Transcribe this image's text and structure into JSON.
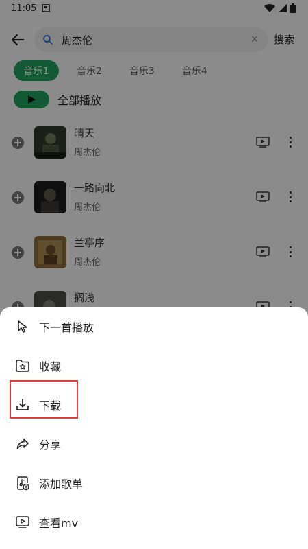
{
  "status_bar": {
    "time": "11:05"
  },
  "search": {
    "query": "周杰伦",
    "button_label": "搜索"
  },
  "tabs": [
    {
      "label": "音乐1",
      "active": true
    },
    {
      "label": "音乐2",
      "active": false
    },
    {
      "label": "音乐3",
      "active": false
    },
    {
      "label": "音乐4",
      "active": false
    }
  ],
  "play_all": {
    "label": "全部播放"
  },
  "songs": [
    {
      "title": "晴天",
      "artist": "周杰伦"
    },
    {
      "title": "一路向北",
      "artist": "周杰伦"
    },
    {
      "title": "兰亭序",
      "artist": "周杰伦"
    },
    {
      "title": "搁浅",
      "artist": ""
    }
  ],
  "sheet": {
    "items": [
      {
        "label": "下一首播放",
        "icon": "cursor-icon"
      },
      {
        "label": "收藏",
        "icon": "folder-star-icon"
      },
      {
        "label": "下载",
        "icon": "download-icon",
        "highlighted": true
      },
      {
        "label": "分享",
        "icon": "share-icon"
      },
      {
        "label": "添加歌单",
        "icon": "add-playlist-icon"
      },
      {
        "label": "查看mv",
        "icon": "mv-icon"
      }
    ]
  },
  "colors": {
    "accent": "#1e9e5a",
    "highlight": "#e03c3c"
  }
}
